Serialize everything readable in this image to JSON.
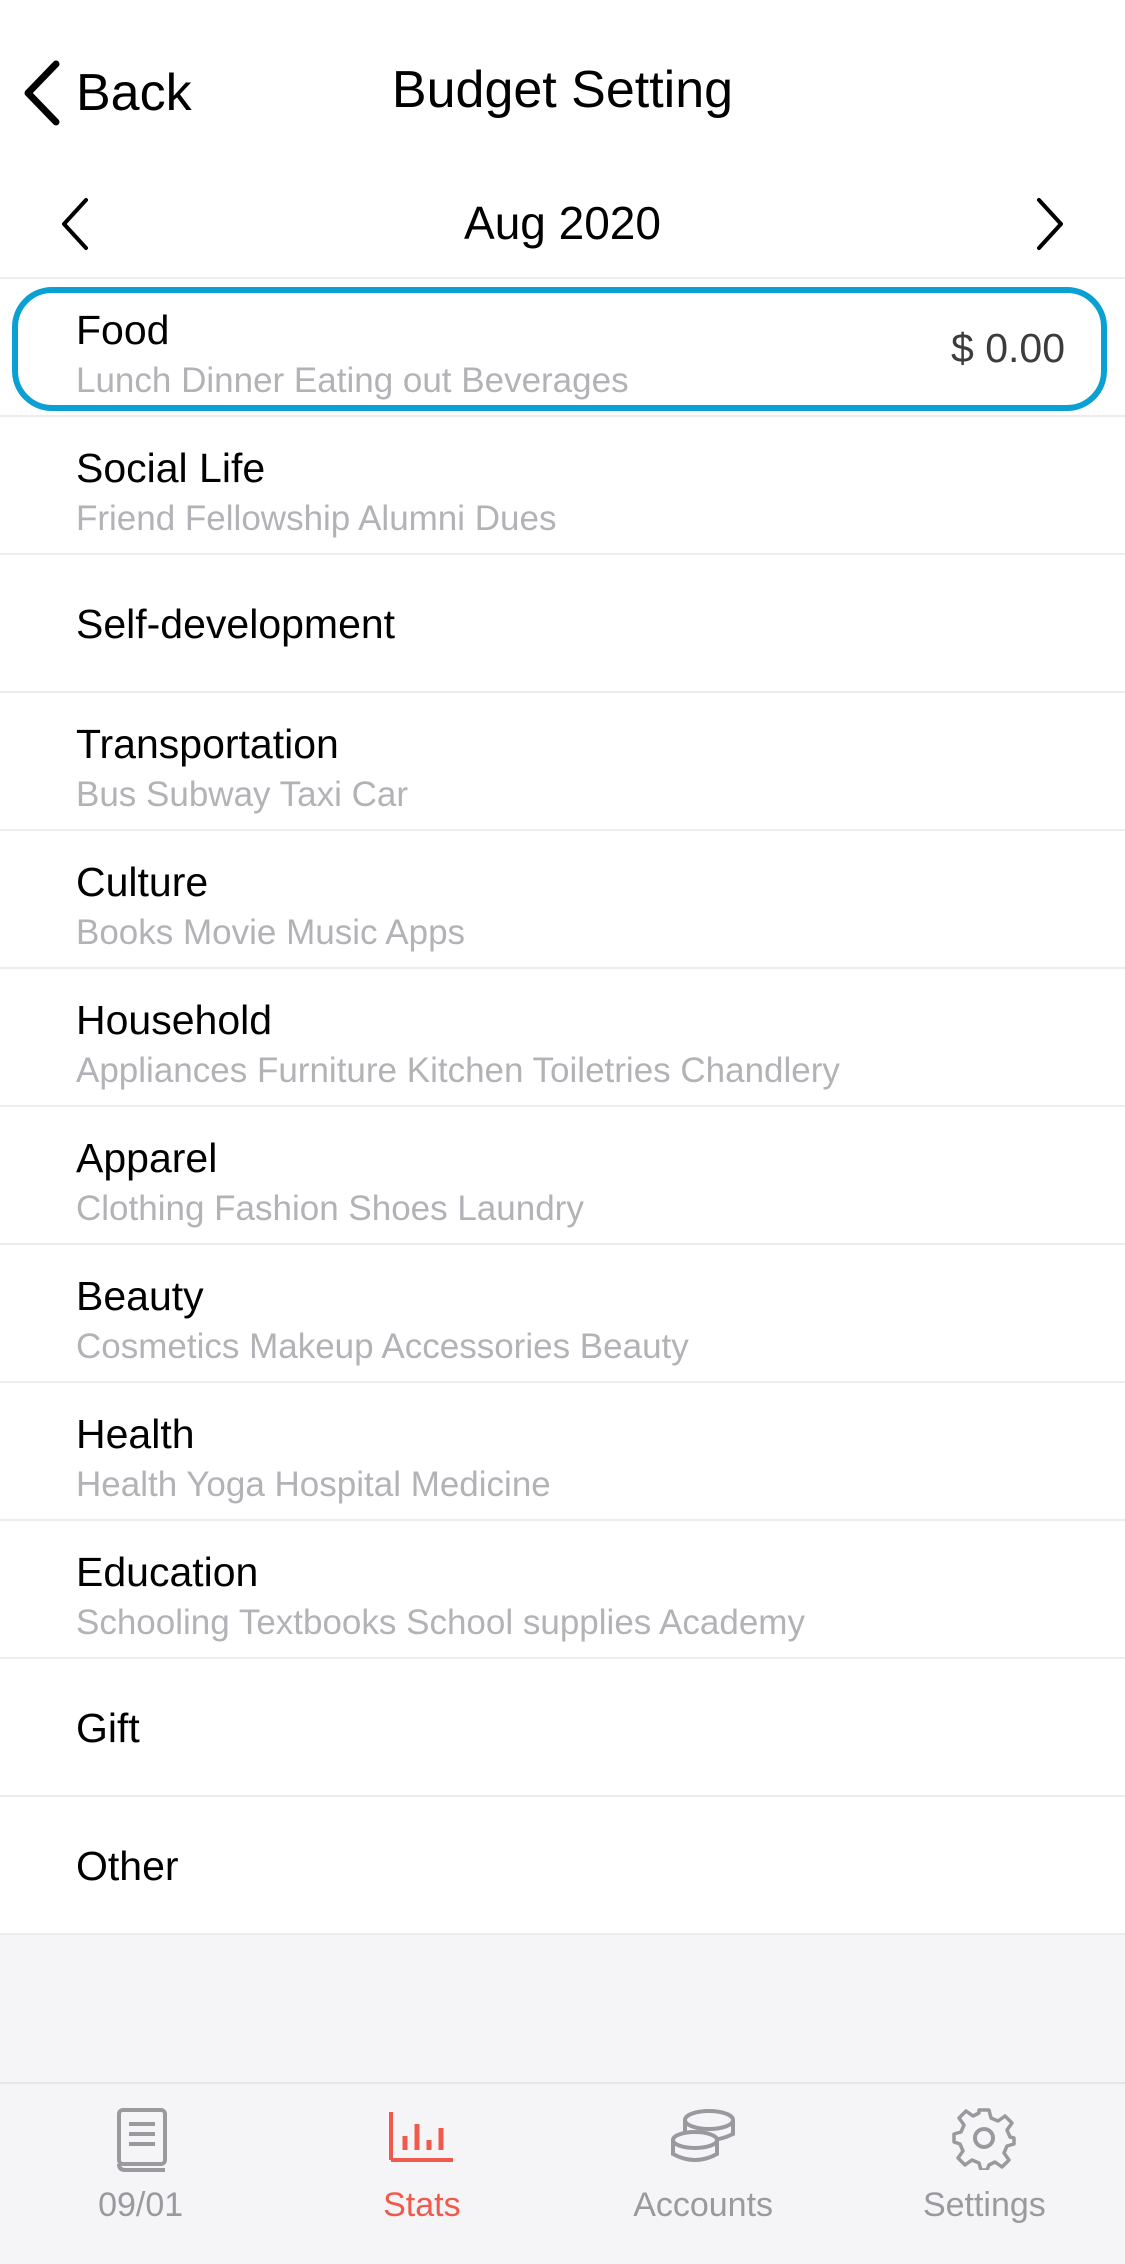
{
  "header": {
    "back_label": "Back",
    "title": "Budget Setting"
  },
  "month_nav": {
    "label": "Aug 2020"
  },
  "categories": [
    {
      "name": "Food",
      "sub": "Lunch Dinner Eating out Beverages",
      "amount": "$ 0.00"
    },
    {
      "name": "Social Life",
      "sub": "Friend Fellowship Alumni Dues"
    },
    {
      "name": "Self-development",
      "sub": ""
    },
    {
      "name": "Transportation",
      "sub": "Bus Subway Taxi Car"
    },
    {
      "name": "Culture",
      "sub": "Books Movie Music Apps"
    },
    {
      "name": "Household",
      "sub": "Appliances Furniture Kitchen Toiletries Chandlery"
    },
    {
      "name": "Apparel",
      "sub": "Clothing Fashion Shoes Laundry"
    },
    {
      "name": "Beauty",
      "sub": "Cosmetics Makeup Accessories Beauty"
    },
    {
      "name": "Health",
      "sub": "Health Yoga Hospital Medicine"
    },
    {
      "name": "Education",
      "sub": "Schooling Textbooks School supplies Academy"
    },
    {
      "name": "Gift",
      "sub": ""
    },
    {
      "name": "Other",
      "sub": ""
    }
  ],
  "tabbar": {
    "tabs": [
      {
        "label": "09/01",
        "icon": "book-icon"
      },
      {
        "label": "Stats",
        "icon": "bar-chart-icon"
      },
      {
        "label": "Accounts",
        "icon": "coins-icon"
      },
      {
        "label": "Settings",
        "icon": "gear-icon"
      }
    ],
    "active_color": "#ef5a4c",
    "inactive_color": "#9a9a9e"
  },
  "colors": {
    "highlight": "#0aa0d3",
    "subtext": "#b3b3b7"
  }
}
